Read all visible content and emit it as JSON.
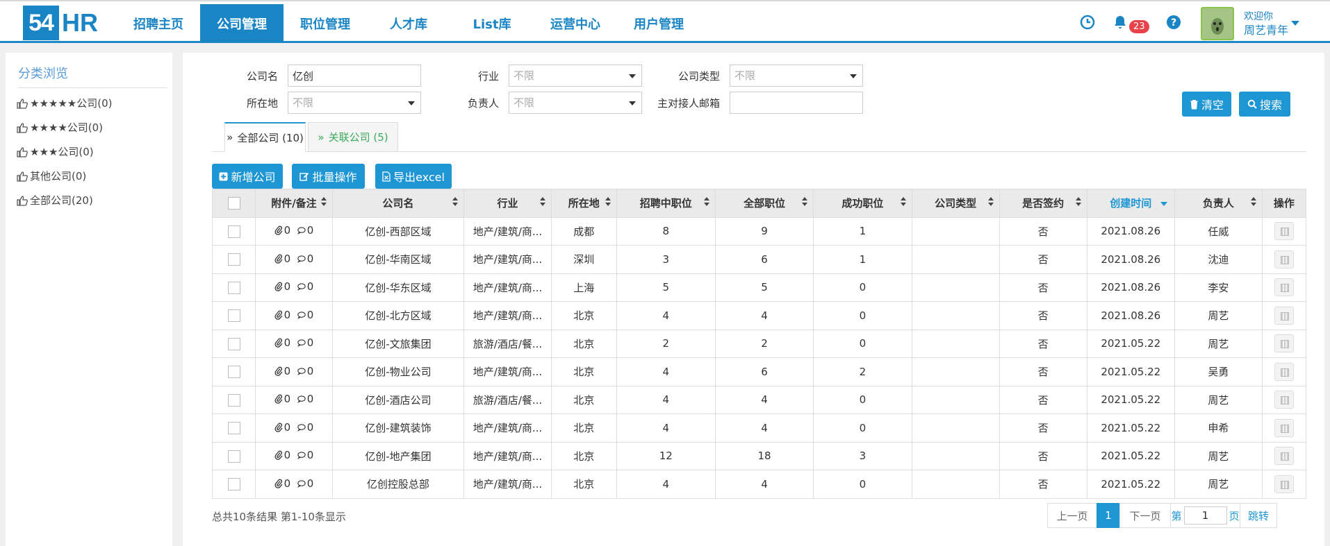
{
  "logo": {
    "num": "54",
    "suffix": "HR"
  },
  "nav": [
    {
      "label": "招聘主页",
      "active": false
    },
    {
      "label": "公司管理",
      "active": true
    },
    {
      "label": "职位管理",
      "active": false
    },
    {
      "label": "人才库",
      "active": false
    },
    {
      "label": "List库",
      "active": false
    },
    {
      "label": "运营中心",
      "active": false
    },
    {
      "label": "用户管理",
      "active": false
    }
  ],
  "header": {
    "notification_count": "23",
    "welcome": "欢迎你",
    "username": "周艺青年"
  },
  "sidebar": {
    "title": "分类浏览",
    "items": [
      {
        "label": "★★★★★公司(0)"
      },
      {
        "label": "★★★★公司(0)"
      },
      {
        "label": "★★★公司(0)"
      },
      {
        "label": "其他公司(0)"
      },
      {
        "label": "全部公司(20)"
      }
    ]
  },
  "filters": {
    "company_label": "公司名",
    "company_value": "亿创",
    "industry_label": "行业",
    "industry_value": "不限",
    "type_label": "公司类型",
    "type_value": "不限",
    "location_label": "所在地",
    "location_value": "不限",
    "owner_label": "负责人",
    "owner_value": "不限",
    "email_label": "主对接人邮箱",
    "email_value": "",
    "clear_label": "清空",
    "search_label": "搜索"
  },
  "tabs": {
    "all": "全部公司 (10)",
    "related": "关联公司 (5)"
  },
  "toolbar": {
    "add": "新增公司",
    "batch": "批量操作",
    "export": "导出excel"
  },
  "table": {
    "headers": [
      "附件/备注",
      "公司名",
      "行业",
      "所在地",
      "招聘中职位",
      "全部职位",
      "成功职位",
      "公司类型",
      "是否签约",
      "创建时间",
      "负责人",
      "操作"
    ],
    "rows": [
      {
        "att": "0",
        "note": "0",
        "name": "亿创-西部区域",
        "industry": "地产/建筑/商...",
        "loc": "成都",
        "hiring": "8",
        "total": "9",
        "success": "1",
        "type": "",
        "signed": "否",
        "created": "2021.08.26",
        "owner": "任威"
      },
      {
        "att": "0",
        "note": "0",
        "name": "亿创-华南区域",
        "industry": "地产/建筑/商...",
        "loc": "深圳",
        "hiring": "3",
        "total": "6",
        "success": "1",
        "type": "",
        "signed": "否",
        "created": "2021.08.26",
        "owner": "沈迪"
      },
      {
        "att": "0",
        "note": "0",
        "name": "亿创-华东区域",
        "industry": "地产/建筑/商...",
        "loc": "上海",
        "hiring": "5",
        "total": "5",
        "success": "0",
        "type": "",
        "signed": "否",
        "created": "2021.08.26",
        "owner": "李安"
      },
      {
        "att": "0",
        "note": "0",
        "name": "亿创-北方区域",
        "industry": "地产/建筑/商...",
        "loc": "北京",
        "hiring": "4",
        "total": "4",
        "success": "0",
        "type": "",
        "signed": "否",
        "created": "2021.08.26",
        "owner": "周艺"
      },
      {
        "att": "0",
        "note": "0",
        "name": "亿创-文旅集团",
        "industry": "旅游/酒店/餐...",
        "loc": "北京",
        "hiring": "2",
        "total": "2",
        "success": "0",
        "type": "",
        "signed": "否",
        "created": "2021.05.22",
        "owner": "周艺"
      },
      {
        "att": "0",
        "note": "0",
        "name": "亿创-物业公司",
        "industry": "地产/建筑/商...",
        "loc": "北京",
        "hiring": "4",
        "total": "6",
        "success": "2",
        "type": "",
        "signed": "否",
        "created": "2021.05.22",
        "owner": "吴勇"
      },
      {
        "att": "0",
        "note": "0",
        "name": "亿创-酒店公司",
        "industry": "旅游/酒店/餐...",
        "loc": "北京",
        "hiring": "4",
        "total": "4",
        "success": "0",
        "type": "",
        "signed": "否",
        "created": "2021.05.22",
        "owner": "周艺"
      },
      {
        "att": "0",
        "note": "0",
        "name": "亿创-建筑装饰",
        "industry": "地产/建筑/商...",
        "loc": "北京",
        "hiring": "4",
        "total": "4",
        "success": "0",
        "type": "",
        "signed": "否",
        "created": "2021.05.22",
        "owner": "申希"
      },
      {
        "att": "0",
        "note": "0",
        "name": "亿创-地产集团",
        "industry": "地产/建筑/商...",
        "loc": "北京",
        "hiring": "12",
        "total": "18",
        "success": "3",
        "type": "",
        "signed": "否",
        "created": "2021.05.22",
        "owner": "周艺"
      },
      {
        "att": "0",
        "note": "0",
        "name": "亿创控股总部",
        "industry": "地产/建筑/商...",
        "loc": "北京",
        "hiring": "4",
        "total": "4",
        "success": "0",
        "type": "",
        "signed": "否",
        "created": "2021.05.22",
        "owner": "周艺"
      }
    ]
  },
  "footer": {
    "summary": "总共10条结果  第1-10条显示",
    "prev": "上一页",
    "current": "1",
    "next": "下一页",
    "goto_prefix": "第",
    "goto_value": "1",
    "goto_suffix": "页",
    "jump": "跳转"
  },
  "colors": {
    "brand": "#1a85c5",
    "button": "#1e96d4",
    "related_tab": "#3aaa5a",
    "badge": "#e8424a"
  }
}
